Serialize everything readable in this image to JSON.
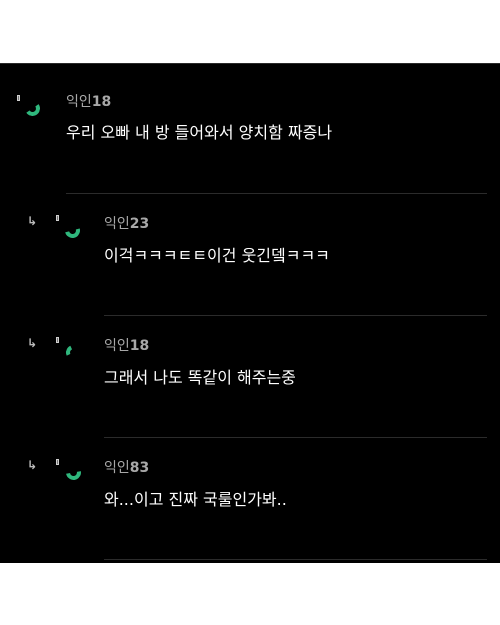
{
  "comments": [
    {
      "author_prefix": "익인",
      "author_number": "18",
      "text": "우리 오빠 내 방 들어와서 양치함 짜증나",
      "is_reply": false
    },
    {
      "author_prefix": "익인",
      "author_number": "23",
      "text": "이걱ㅋㅋㅋㅌㅌ이건 웃긴뎈ㅋㅋㅋ",
      "is_reply": true
    },
    {
      "author_prefix": "익인",
      "author_number": "18",
      "text": "그래서 나도 똑같이 해주는중",
      "is_reply": true
    },
    {
      "author_prefix": "익인",
      "author_number": "83",
      "text": "와...이고 진짜 국룰인가봐..",
      "is_reply": true
    }
  ],
  "reply_arrow_glyph": "↳",
  "colors": {
    "background": "#000000",
    "accent": "#2fb77d",
    "author": "#a8a8a8",
    "text": "#ffffff"
  },
  "icons": {
    "reply": "reply-arrow-icon",
    "avatar": "anonymous-avatar-icon"
  }
}
